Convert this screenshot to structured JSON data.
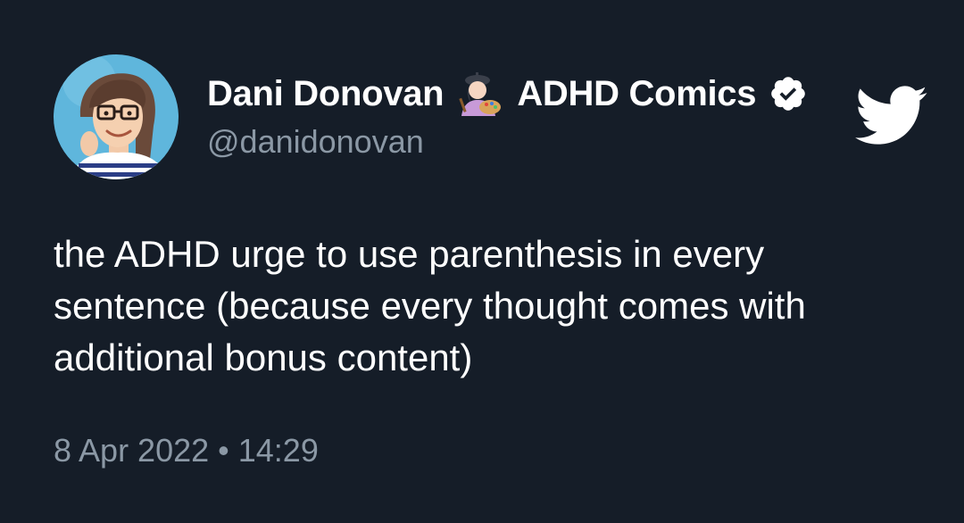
{
  "author": {
    "display_name": "Dani Donovan",
    "emoji_icon": "artist-woman-emoji",
    "suffix": "ADHD Comics",
    "verified_icon": "verified-badge-icon",
    "handle": "@danidonovan",
    "avatar_icon": "illustrated-woman-avatar"
  },
  "brand": {
    "icon": "twitter-bird-icon",
    "color": "#ffffff"
  },
  "tweet": {
    "text": "the ADHD urge to use parenthesis in every\nsentence (because every thought comes with\nadditional bonus content)",
    "timestamp": "8 Apr 2022 • 14:29"
  },
  "colors": {
    "background": "#151d28",
    "primary_text": "#ffffff",
    "secondary_text": "#8b98a5"
  }
}
